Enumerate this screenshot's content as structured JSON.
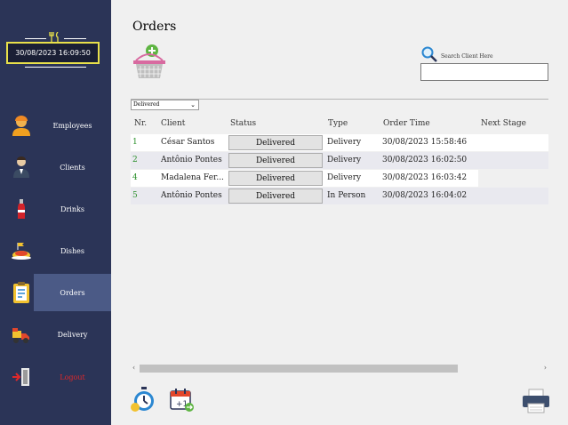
{
  "sidebar": {
    "datetime": "30/08/2023 16:09:50",
    "items": [
      {
        "label": "Employees",
        "icon": "employee-icon"
      },
      {
        "label": "Clients",
        "icon": "client-icon"
      },
      {
        "label": "Drinks",
        "icon": "drink-icon"
      },
      {
        "label": "Dishes",
        "icon": "dish-icon"
      },
      {
        "label": "Orders",
        "icon": "clipboard-icon"
      },
      {
        "label": "Delivery",
        "icon": "delivery-icon"
      },
      {
        "label": "Logout",
        "icon": "logout-icon"
      }
    ]
  },
  "main": {
    "title": "Orders",
    "search": {
      "label": "Search Client Here",
      "value": ""
    },
    "filter": {
      "selected": "Delivered"
    },
    "columns": [
      "Nr.",
      "Client",
      "Status",
      "Type",
      "Order Time",
      "Next Stage"
    ],
    "orders": [
      {
        "nr": "1",
        "client": "César Santos",
        "status": "Delivered",
        "type": "Delivery",
        "time": "30/08/2023 15:58:46"
      },
      {
        "nr": "2",
        "client": "Antônio Pontes",
        "status": "Delivered",
        "type": "Delivery",
        "time": "30/08/2023 16:02:50"
      },
      {
        "nr": "4",
        "client": "Madalena  Fer...",
        "status": "Delivered",
        "type": "Delivery",
        "time": "30/08/2023 16:03:42"
      },
      {
        "nr": "5",
        "client": "Antônio Pontes",
        "status": "Delivered",
        "type": "In Person",
        "time": "30/08/2023 16:04:02"
      }
    ]
  },
  "colors": {
    "sidebar": "#2b3457",
    "active": "#4b5a86",
    "accent": "#e8e04a",
    "logout": "#e0282a",
    "nr": "#2a8f2a"
  }
}
